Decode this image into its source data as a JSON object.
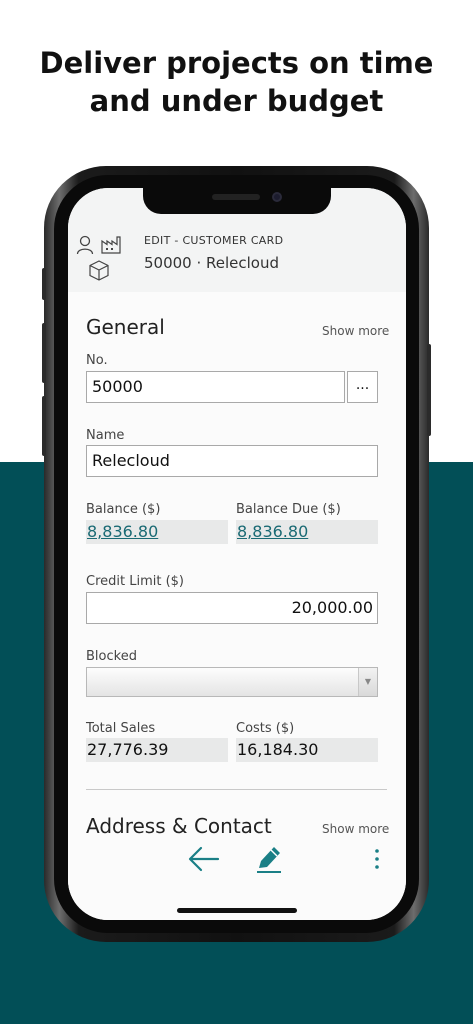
{
  "promo": {
    "headline_line1": "Deliver projects on time",
    "headline_line2": "and under budget",
    "band_color": "#024f57"
  },
  "header": {
    "icons": [
      "person-icon",
      "factory-icon",
      "box-icon"
    ],
    "caption": "EDIT - CUSTOMER CARD",
    "record": "50000 · Relecloud"
  },
  "general": {
    "title": "General",
    "show_more": "Show more",
    "no_label": "No.",
    "no_value": "50000",
    "lookup_label": "...",
    "name_label": "Name",
    "name_value": "Relecloud",
    "balance_label": "Balance ($)",
    "balance_value": "8,836.80",
    "balance_due_label": "Balance Due ($)",
    "balance_due_value": "8,836.80",
    "credit_limit_label": "Credit Limit ($)",
    "credit_limit_value": "20,000.00",
    "blocked_label": "Blocked",
    "blocked_value": "",
    "total_sales_label": "Total Sales",
    "total_sales_value": "27,776.39",
    "costs_label": "Costs ($)",
    "costs_value": "16,184.30"
  },
  "address": {
    "title": "Address & Contact",
    "show_more": "Show more"
  },
  "bottom_bar": {
    "icons": [
      "back-arrow-icon",
      "edit-pencil-icon",
      "more-vertical-icon"
    ],
    "accent": "#1a7f86"
  }
}
